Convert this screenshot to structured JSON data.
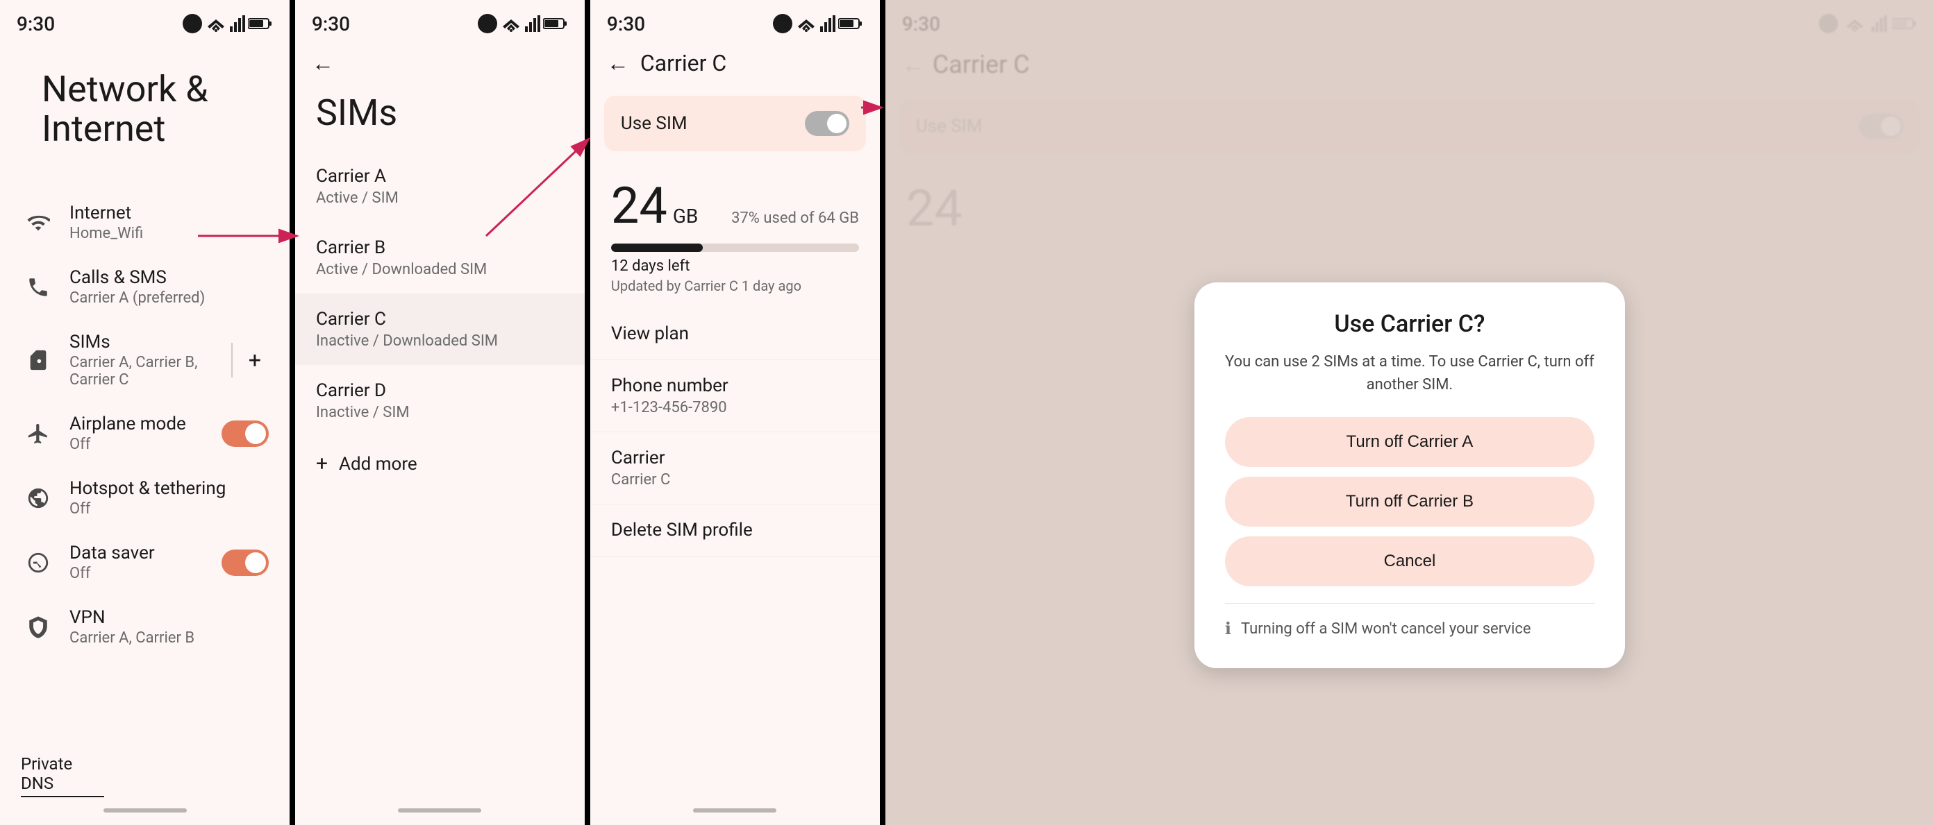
{
  "screen1": {
    "status_time": "9:30",
    "title": "Network & Internet",
    "items": [
      {
        "id": "internet",
        "label": "Internet",
        "sublabel": "Home_Wifi",
        "icon": "wifi"
      },
      {
        "id": "calls_sms",
        "label": "Calls & SMS",
        "sublabel": "Carrier A (preferred)",
        "icon": "phone"
      },
      {
        "id": "sims",
        "label": "SIMs",
        "sublabel": "Carrier A, Carrier B, Carrier C",
        "icon": "sim"
      },
      {
        "id": "airplane",
        "label": "Airplane mode",
        "sublabel": "Off",
        "icon": "airplane",
        "toggle": true,
        "toggle_state": "on"
      },
      {
        "id": "hotspot",
        "label": "Hotspot & tethering",
        "sublabel": "Off",
        "icon": "hotspot"
      },
      {
        "id": "data_saver",
        "label": "Data saver",
        "sublabel": "Off",
        "icon": "data_saver",
        "toggle": true,
        "toggle_state": "on"
      },
      {
        "id": "vpn",
        "label": "VPN",
        "sublabel": "Carrier A, Carrier B",
        "icon": "vpn"
      }
    ],
    "footer": "Private DNS"
  },
  "screen2": {
    "status_time": "9:30",
    "title": "SIMs",
    "carriers": [
      {
        "name": "Carrier A",
        "status": "Active / SIM"
      },
      {
        "name": "Carrier B",
        "status": "Active / Downloaded SIM"
      },
      {
        "name": "Carrier C",
        "status": "Inactive / Downloaded SIM"
      },
      {
        "name": "Carrier D",
        "status": "Inactive / SIM"
      }
    ],
    "add_more": "Add more"
  },
  "screen3": {
    "status_time": "9:30",
    "title": "Carrier C",
    "use_sim_label": "Use SIM",
    "data_number": "24",
    "data_unit": "GB",
    "data_percent": "37% used of 64 GB",
    "data_bar_width": "37%",
    "days_left": "12 days left",
    "updated": "Updated by Carrier C 1 day ago",
    "items": [
      {
        "id": "view_plan",
        "label": "View plan",
        "value": ""
      },
      {
        "id": "phone_number",
        "label": "Phone number",
        "value": "+1-123-456-7890"
      },
      {
        "id": "carrier",
        "label": "Carrier",
        "value": "Carrier C"
      },
      {
        "id": "delete_sim",
        "label": "Delete SIM profile",
        "value": ""
      }
    ]
  },
  "screen4": {
    "status_time": "9:30",
    "title": "Carrier C",
    "use_sim_label": "Use SIM",
    "dialog": {
      "title": "Use Carrier C?",
      "description": "You can use 2 SIMs at a time. To use Carrier C, turn off another SIM.",
      "btn1": "Turn off Carrier A",
      "btn2": "Turn off Carrier B",
      "btn3": "Cancel",
      "note": "Turning off a SIM won't cancel your service"
    }
  }
}
